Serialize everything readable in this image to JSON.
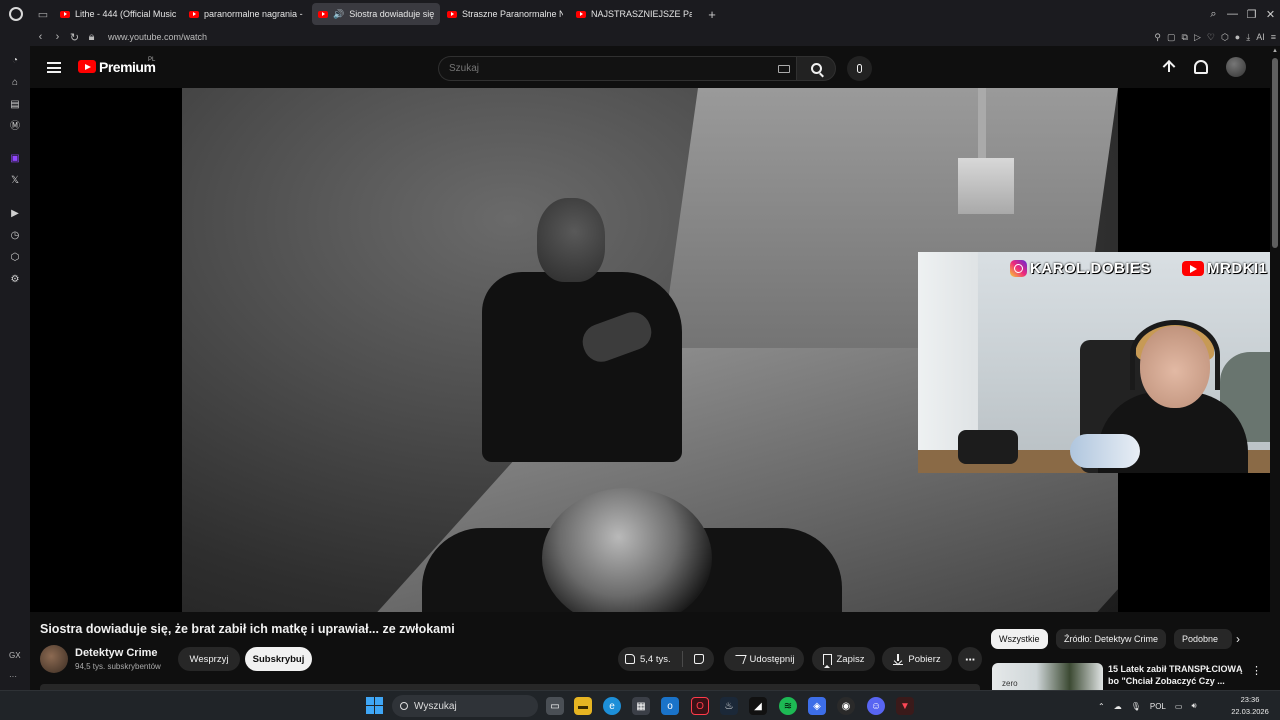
{
  "browser": {
    "tabs": [
      {
        "label": "Lithe - 444 (Official Music",
        "active": false,
        "playing": false
      },
      {
        "label": "paranormalne nagrania - ",
        "active": false,
        "playing": false
      },
      {
        "label": "Siostra dowiaduje się,",
        "active": true,
        "playing": true
      },
      {
        "label": "Straszne Paranormalne Na",
        "active": false,
        "playing": false
      },
      {
        "label": "NAJSTRASZNIEJSZE Para",
        "active": false,
        "playing": false
      }
    ],
    "new_tab": "+",
    "url": "www.youtube.com/watch",
    "ai_label": "AI",
    "sidebar_label": "GX",
    "sidebar_more": "···"
  },
  "youtube": {
    "brand": "Premium",
    "country": "PL",
    "search_placeholder": "Szukaj"
  },
  "overlay": {
    "instagram_handle": "KAROL.DOBIES",
    "youtube_handle": "MRDKI1"
  },
  "video": {
    "title": "Siostra dowiaduje się, że brat zabił ich matkę i uprawiał... ze zwłokami",
    "channel_name": "Detektyw Crime",
    "subscribers": "94,5 tys. subskrybentów",
    "support_label": "Wesprzyj",
    "subscribe_label": "Subskrybuj",
    "likes": "5,4 tys.",
    "share_label": "Udostępnij",
    "save_label": "Zapisz",
    "download_label": "Pobierz",
    "more_label": "⋮"
  },
  "sidebar_panel": {
    "chips": [
      "Wszystkie",
      "Źródło: Detektyw Crime",
      "Podobne"
    ],
    "active_chip": 0,
    "next_arrow": "›",
    "recommendation": {
      "title": "15 Latek zabił TRANSPŁCIOWĄ bo \"Chciał Zobaczyć Czy ...",
      "thumb_text": "zero",
      "more": "⋮"
    }
  },
  "taskbar": {
    "search_label": "Wyszukaj",
    "language": "POL",
    "time": "23:36",
    "date": "22.03.2026"
  },
  "colors": {
    "youtube_red": "#ff0000",
    "background": "#0f0f0f",
    "chip_active": "#f1f1f1",
    "windows_accent": "#3fa6f5"
  }
}
